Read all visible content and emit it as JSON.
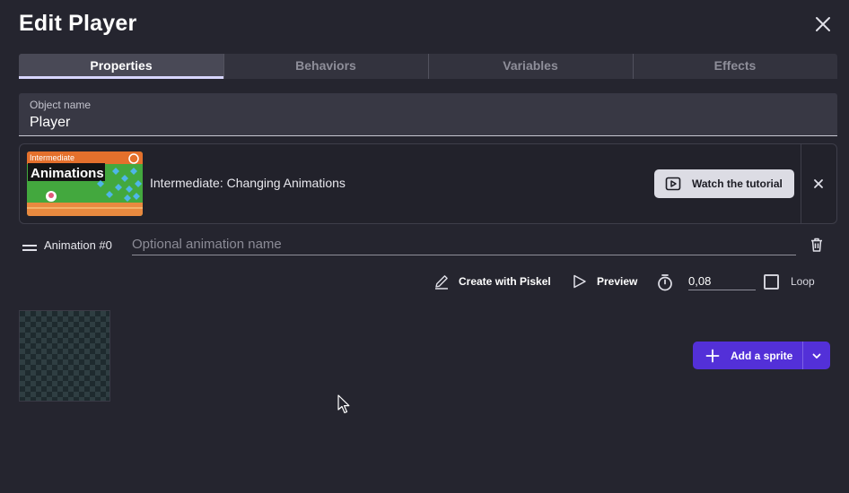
{
  "dialog": {
    "title": "Edit Player"
  },
  "tabs": [
    {
      "label": "Properties",
      "active": true
    },
    {
      "label": "Behaviors",
      "active": false
    },
    {
      "label": "Variables",
      "active": false
    },
    {
      "label": "Effects",
      "active": false
    }
  ],
  "object_name": {
    "label": "Object name",
    "value": "Player"
  },
  "tutorial": {
    "thumbnail_tag": "Intermediate",
    "thumbnail_title": "Animations",
    "title": "Intermediate: Changing Animations",
    "watch_label": "Watch the tutorial",
    "icon": "play-video-icon"
  },
  "animation": {
    "label": "Animation #0",
    "name_placeholder": "Optional animation name",
    "name_value": ""
  },
  "toolbar": {
    "piskel_label": "Create with Piskel",
    "preview_label": "Preview",
    "fps_value": "0,08",
    "loop_label": "Loop",
    "loop_checked": false
  },
  "add_sprite": {
    "label": "Add a sprite"
  },
  "colors": {
    "background": "#25252f",
    "accent": "#5330d8",
    "active_tab_indicator": "#d8d6ff"
  }
}
